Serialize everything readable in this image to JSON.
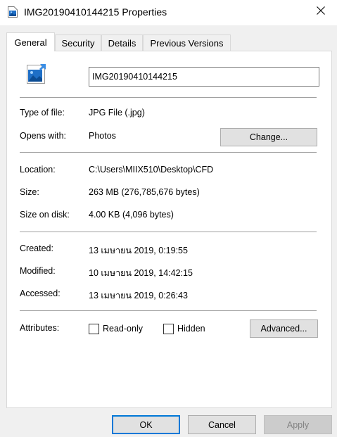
{
  "window": {
    "title": "IMG20190410144215 Properties"
  },
  "tabs": [
    {
      "label": "General"
    },
    {
      "label": "Security"
    },
    {
      "label": "Details"
    },
    {
      "label": "Previous Versions"
    }
  ],
  "general": {
    "filename": "IMG20190410144215",
    "type_label": "Type of file:",
    "type_value": "JPG File (.jpg)",
    "opens_label": "Opens with:",
    "opens_value": "Photos",
    "change_button": "Change...",
    "location_label": "Location:",
    "location_value": "C:\\Users\\MIIX510\\Desktop\\CFD",
    "size_label": "Size:",
    "size_value": "263 MB (276,785,676 bytes)",
    "size_on_disk_label": "Size on disk:",
    "size_on_disk_value": "4.00 KB (4,096 bytes)",
    "created_label": "Created:",
    "created_value": "13 เมษายน 2019, 0:19:55",
    "modified_label": "Modified:",
    "modified_value": "10 เมษายน 2019, 14:42:15",
    "accessed_label": "Accessed:",
    "accessed_value": "13 เมษายน 2019, 0:26:43",
    "attributes_label": "Attributes:",
    "readonly_label": "Read-only",
    "hidden_label": "Hidden",
    "advanced_button": "Advanced..."
  },
  "footer": {
    "ok": "OK",
    "cancel": "Cancel",
    "apply": "Apply"
  },
  "icons": {
    "title": "image-file-icon",
    "file": "image-file-icon",
    "close": "close-icon"
  },
  "colors": {
    "accent": "#0078d7",
    "icon_blue": "#1e6fc7"
  }
}
